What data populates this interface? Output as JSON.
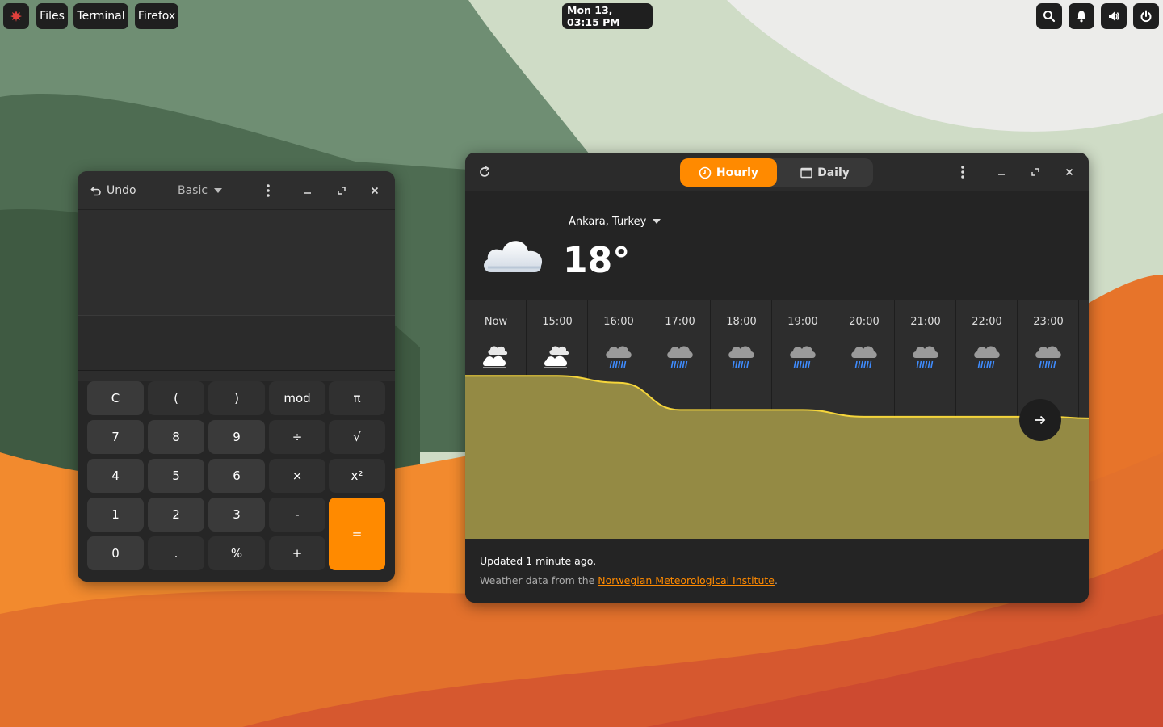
{
  "topbar": {
    "apps": [
      "Files",
      "Terminal",
      "Firefox"
    ],
    "clock": "Mon 13, 03:15 PM"
  },
  "calculator": {
    "undo_label": "Undo",
    "mode_label": "Basic",
    "keys": [
      "C",
      "(",
      ")",
      "mod",
      "π",
      "7",
      "8",
      "9",
      "÷",
      "√",
      "4",
      "5",
      "6",
      "×",
      "x²",
      "1",
      "2",
      "3",
      "-",
      "=",
      "0",
      ".",
      "%",
      "+"
    ]
  },
  "weather": {
    "tabs": {
      "hourly": "Hourly",
      "daily": "Daily"
    },
    "location": "Ankara, Turkey",
    "current_temp": "18°",
    "hours": [
      {
        "time": "Now",
        "temp": "18°",
        "icon": "cloudy-icon"
      },
      {
        "time": "15:00",
        "temp": "18°",
        "icon": "cloudy-icon"
      },
      {
        "time": "16:00",
        "temp": "17°",
        "icon": "rain-icon"
      },
      {
        "time": "17:00",
        "temp": "13°",
        "icon": "rain-icon"
      },
      {
        "time": "18:00",
        "temp": "13°",
        "icon": "rain-icon"
      },
      {
        "time": "19:00",
        "temp": "13°",
        "icon": "rain-icon"
      },
      {
        "time": "20:00",
        "temp": "12°",
        "icon": "rain-icon"
      },
      {
        "time": "21:00",
        "temp": "12°",
        "icon": "rain-icon"
      },
      {
        "time": "22:00",
        "temp": "12°",
        "icon": "rain-icon"
      },
      {
        "time": "23:00",
        "temp": "12°",
        "icon": "rain-icon"
      }
    ],
    "updated": "Updated 1 minute ago.",
    "source_prefix": "Weather data from the ",
    "source_link": "Norwegian Meteorological Institute",
    "source_suffix": "."
  },
  "colors": {
    "accent": "#ff8a00",
    "chart_fill": "#948a44",
    "chart_line": "#f5d53b"
  }
}
